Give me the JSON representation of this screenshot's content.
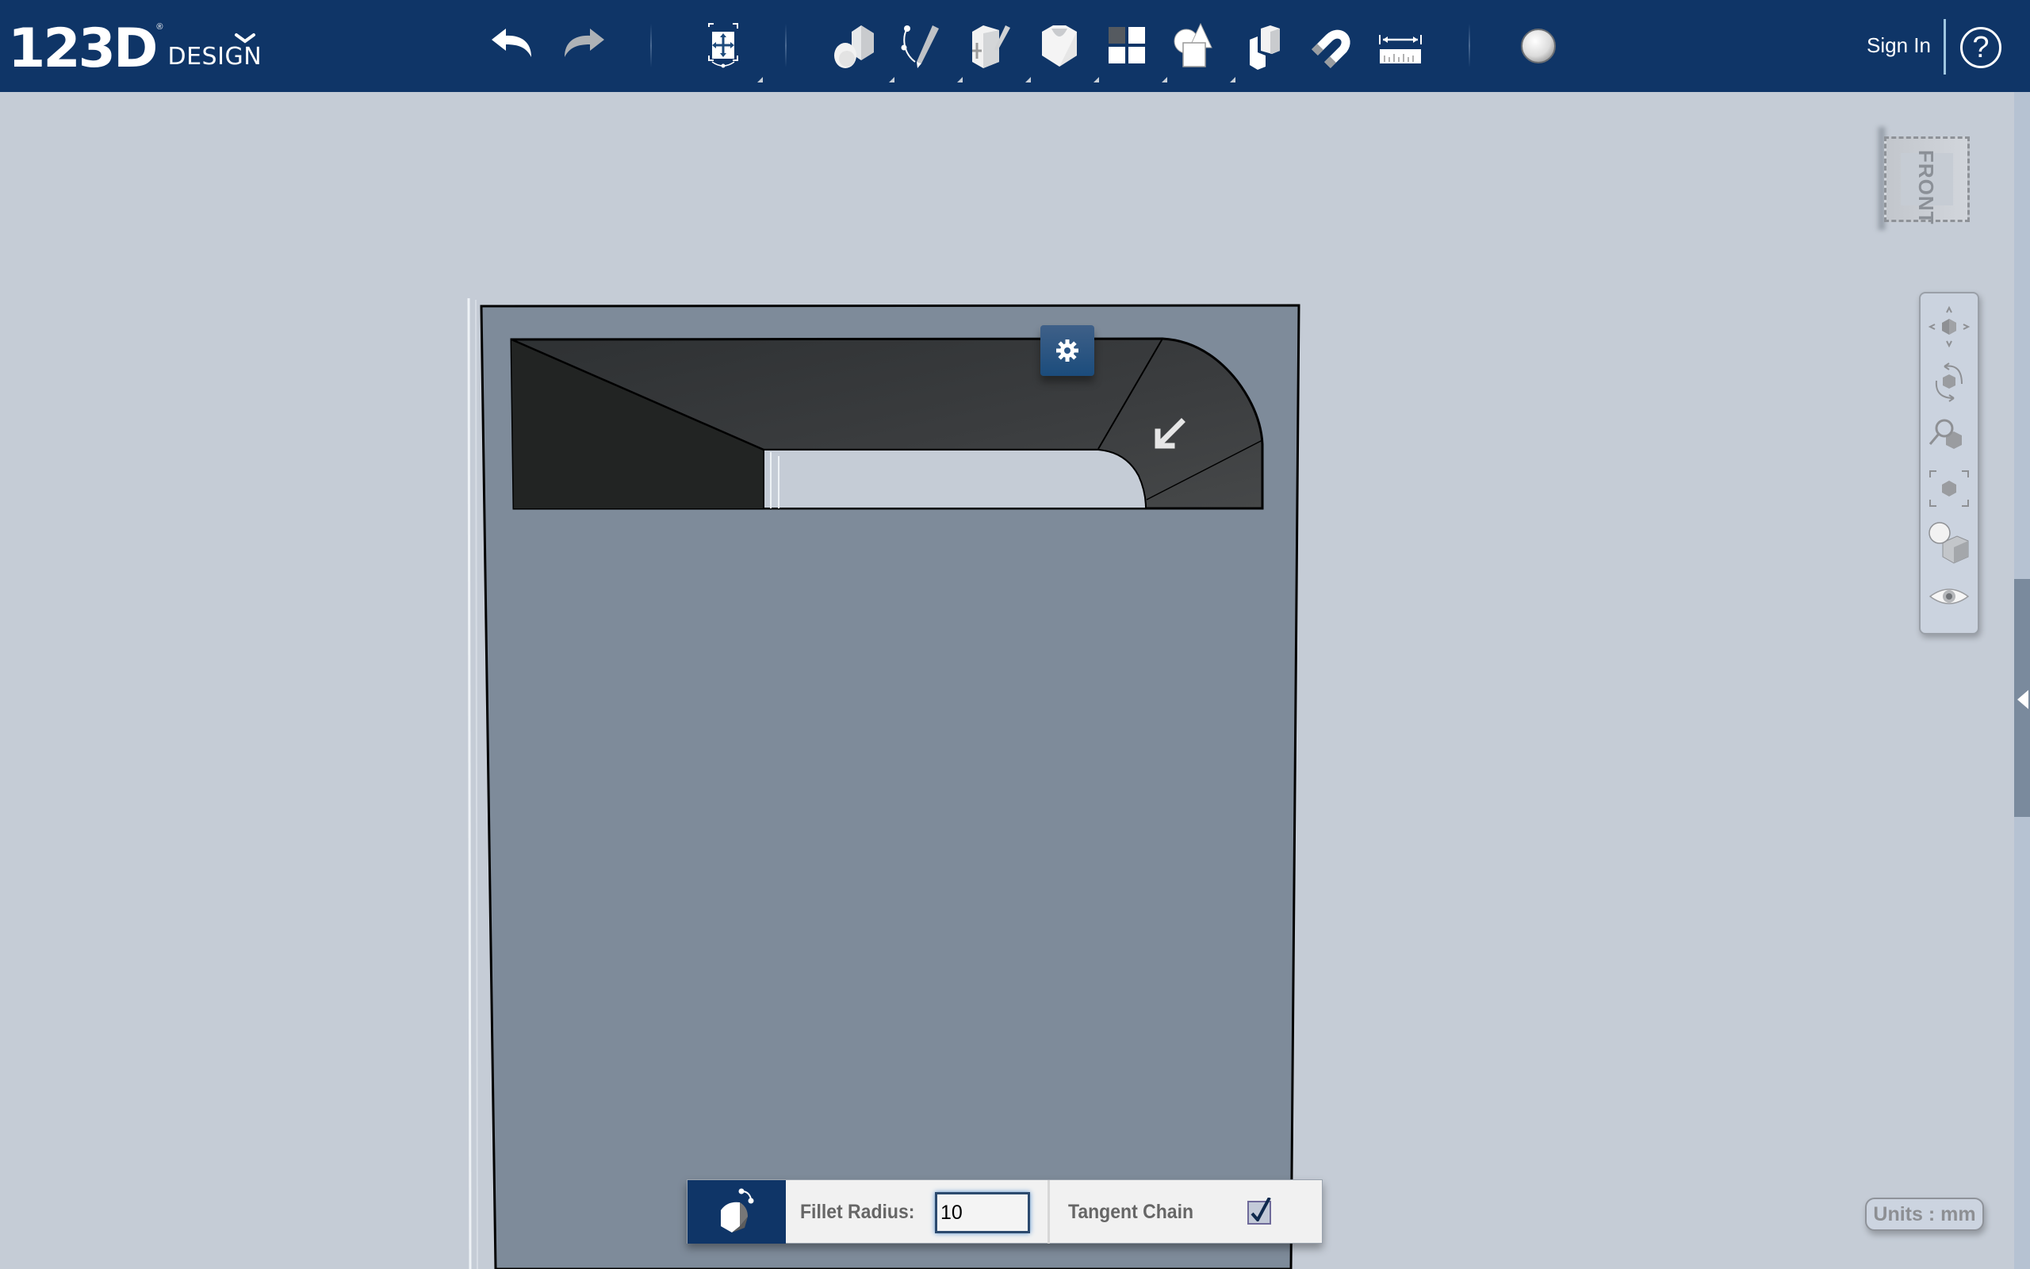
{
  "header": {
    "logo_number": "123D",
    "logo_reg": "®",
    "logo_word": "DESIGN",
    "sign_in": "Sign In",
    "help": "?"
  },
  "toolbar": {
    "items": [
      {
        "name": "undo",
        "icon": "undo-arrow-icon"
      },
      {
        "name": "redo",
        "icon": "redo-arrow-icon",
        "disabled": true
      },
      {
        "name": "transform",
        "icon": "transform-icon",
        "flyout": true
      },
      {
        "name": "primitives",
        "icon": "primitives-icon",
        "flyout": true
      },
      {
        "name": "sketch",
        "icon": "sketch-icon",
        "flyout": true
      },
      {
        "name": "construct",
        "icon": "construct-icon",
        "flyout": true
      },
      {
        "name": "modify",
        "icon": "modify-icon",
        "flyout": true
      },
      {
        "name": "pattern",
        "icon": "pattern-icon",
        "flyout": true
      },
      {
        "name": "combine",
        "icon": "combine-icon",
        "flyout": true
      },
      {
        "name": "group",
        "icon": "group-icon"
      },
      {
        "name": "snap",
        "icon": "snap-magnet-icon"
      },
      {
        "name": "measure",
        "icon": "measure-ruler-icon"
      },
      {
        "name": "material",
        "icon": "material-sphere-icon"
      }
    ]
  },
  "viewcube": {
    "label": "FRONT"
  },
  "navbar": {
    "items": [
      "pan",
      "orbit",
      "zoom",
      "fit",
      "views",
      "visibility"
    ]
  },
  "fillet": {
    "radius_label": "Fillet Radius:",
    "radius_value": "10",
    "tangent_label": "Tangent Chain",
    "tangent_checked": true
  },
  "status": {
    "units": "Units : mm"
  },
  "colors": {
    "header": "#0f3567",
    "background": "#c5ccd6",
    "model_face": "#7e8b9a",
    "recess": "#3a3c3e",
    "accent": "#1b4c7c"
  }
}
